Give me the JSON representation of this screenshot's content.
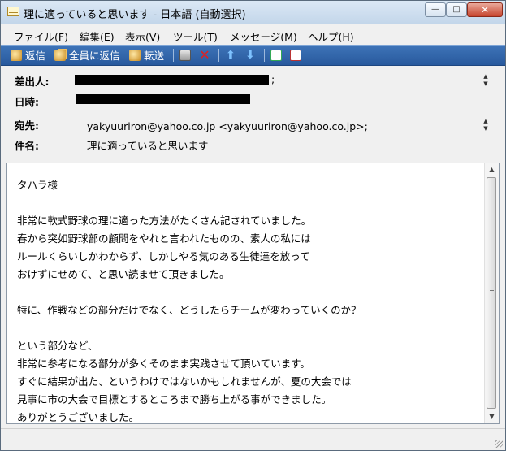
{
  "window": {
    "title": "理に適っていると思います - 日本語 (自動選択)",
    "min_glyph": "—",
    "max_glyph": "□",
    "close_glyph": "✕"
  },
  "menu": {
    "items": [
      "ファイル(F)",
      "編集(E)",
      "表示(V)",
      "ツール(T)",
      "メッセージ(M)",
      "ヘルプ(H)"
    ]
  },
  "toolbar": {
    "reply_label": "返信",
    "reply_all_label": "全員に返信",
    "forward_label": "転送",
    "up_glyph": "⬆",
    "down_glyph": "⬇",
    "delete_glyph": "✕"
  },
  "header": {
    "from_label": "差出人:",
    "from_suffix": ";",
    "date_label": "日時:",
    "to_label": "宛先:",
    "to_value": "yakyuuriron@yahoo.co.jp <yakyuuriron@yahoo.co.jp>;",
    "subject_label": "件名:",
    "subject_value": "理に適っていると思います"
  },
  "message": {
    "lines": [
      "タハラ様",
      "",
      "非常に軟式野球の理に適った方法がたくさん記されていました。",
      "春から突如野球部の顧問をやれと言われたものの、素人の私には",
      "ルールくらいしかわからず、しかしやる気のある生徒達を放って",
      "おけずにせめて、と思い読ませて頂きました。",
      "",
      "特に、作戦などの部分だけでなく、どうしたらチームが変わっていくのか？",
      "",
      "という部分など、",
      "非常に参考になる部分が多くそのまま実践させて頂いています。",
      "すぐに結果が出た、というわけではないかもしれませんが、夏の大会では",
      "見事に市の大会で目標とするところまで勝ち上がる事ができました。",
      "ありがとうございました。"
    ]
  },
  "colors": {
    "toolbar": "#2f62a8",
    "title_bar": "#c9dbee",
    "close_button": "#c7452e"
  }
}
